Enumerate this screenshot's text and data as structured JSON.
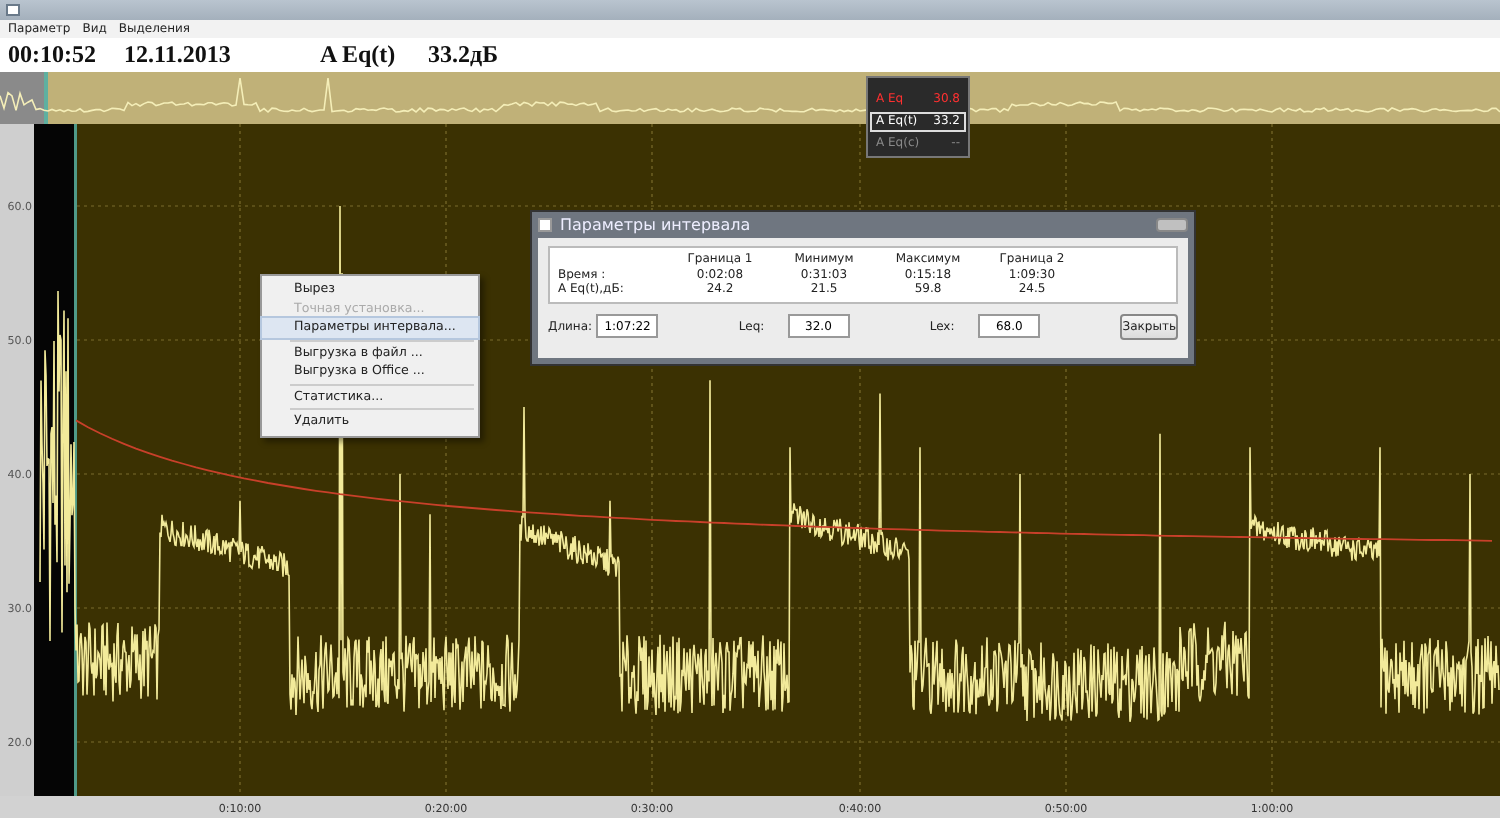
{
  "menu_bar": [
    {
      "label": "Параметр"
    },
    {
      "label": "Вид"
    },
    {
      "label": "Выделения"
    }
  ],
  "header": {
    "time": "00:10:52",
    "date": "12.11.2013",
    "parameter": "A Eq(t)",
    "value": "33.2дБ"
  },
  "legend": [
    {
      "label": "A Eq",
      "value": "30.8",
      "color": "#ff3030",
      "selected": false
    },
    {
      "label": "A Eq(t)",
      "value": "33.2",
      "color": "#ffffff",
      "selected": true
    },
    {
      "label": "A Eq(c)",
      "value": "--",
      "color": "#8a8a8a",
      "selected": false
    }
  ],
  "y_ticks": [
    "60.0",
    "50.0",
    "40.0",
    "30.0",
    "20.0"
  ],
  "x_ticks": [
    "0:10:00",
    "0:20:00",
    "0:30:00",
    "0:40:00",
    "0:50:00",
    "1:00:00"
  ],
  "context_menu": [
    {
      "kind": "item",
      "label": "Вырез",
      "disabled": false,
      "selected": false
    },
    {
      "kind": "item",
      "label": "Точная установка...",
      "disabled": true,
      "selected": false
    },
    {
      "kind": "item",
      "label": "Параметры интервала...",
      "disabled": false,
      "selected": true
    },
    {
      "kind": "separator"
    },
    {
      "kind": "item",
      "label": "Выгрузка в файл ...",
      "disabled": false,
      "selected": false
    },
    {
      "kind": "item",
      "label": "Выгрузка в Office ...",
      "disabled": false,
      "selected": false
    },
    {
      "kind": "separator"
    },
    {
      "kind": "item",
      "label": "Статистика...",
      "disabled": false,
      "selected": false
    },
    {
      "kind": "separator"
    },
    {
      "kind": "item",
      "label": "Удалить",
      "disabled": false,
      "selected": false
    }
  ],
  "dialog": {
    "title": "Параметры интервала",
    "columns": [
      "Граница 1",
      "Минимум",
      "Максимум",
      "Граница 2"
    ],
    "rows": [
      {
        "label": "Время :",
        "cells": [
          "0:02:08",
          "0:31:03",
          "0:15:18",
          "1:09:30"
        ]
      },
      {
        "label": "A Eq(t),дБ:",
        "cells": [
          "24.2",
          "21.5",
          "59.8",
          "24.5"
        ]
      }
    ],
    "fields": [
      {
        "label": "Длина:",
        "value": "1:07:22"
      },
      {
        "label": "Leq:",
        "value": "32.0"
      },
      {
        "label": "Lex:",
        "value": "68.0"
      }
    ],
    "button": "Закрыть"
  }
}
